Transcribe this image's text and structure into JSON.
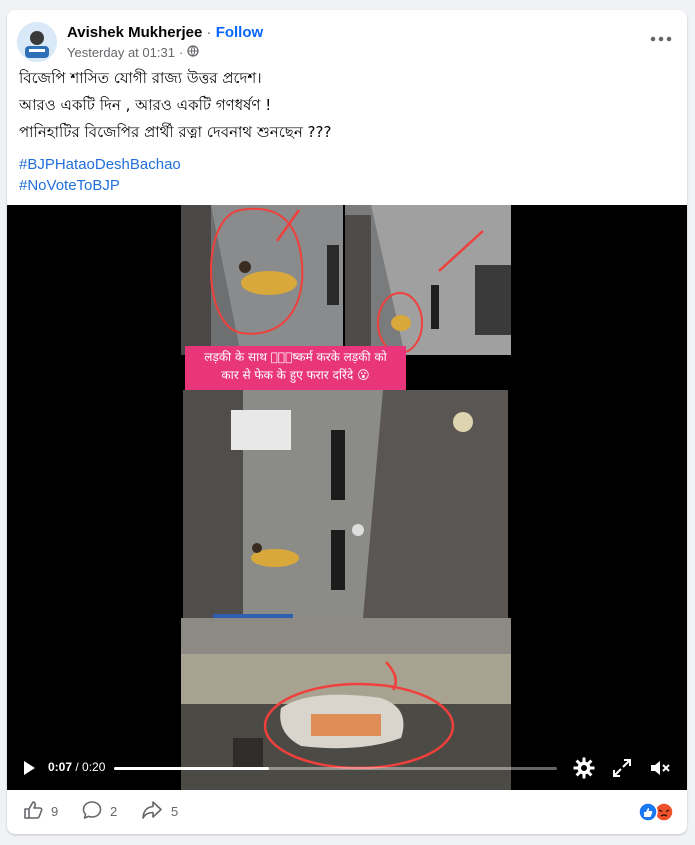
{
  "post": {
    "author": "Avishek Mukherjee",
    "separator": "·",
    "follow_label": "Follow",
    "timestamp": "Yesterday at 01:31",
    "meta_separator": "·",
    "audience_icon": "globe-icon",
    "text_lines": [
      "বিজেপি শাসিত যোগী রাজ্য উত্তর প্রদেশ।",
      "আরও একটি দিন , আরও একটি গণধর্ষণ !",
      "পানিহাটির বিজেপির প্রার্থী রত্না দেবনাথ শুনছেন ???"
    ],
    "hashtags": [
      "#BJPHataoDeshBachao",
      "#NoVoteToBJP"
    ]
  },
  "video": {
    "caption_line1": "लड़की के साथ दु᳚ष्कर्म करके लड़की को",
    "caption_line2": "कार से फेक के हुए फरार दरिंदे 😮",
    "current_time": "0:07",
    "time_separator": " / ",
    "duration": "0:20",
    "progress_fraction": 0.35,
    "icons": [
      "play-icon",
      "settings-icon",
      "fullscreen-icon",
      "mute-icon"
    ]
  },
  "footer": {
    "like_count": "9",
    "comment_count": "2",
    "share_count": "5"
  },
  "colors": {
    "accent": "#0866ff",
    "caption_bg": "#e9357a",
    "highlight_circle": "#f0403c"
  }
}
